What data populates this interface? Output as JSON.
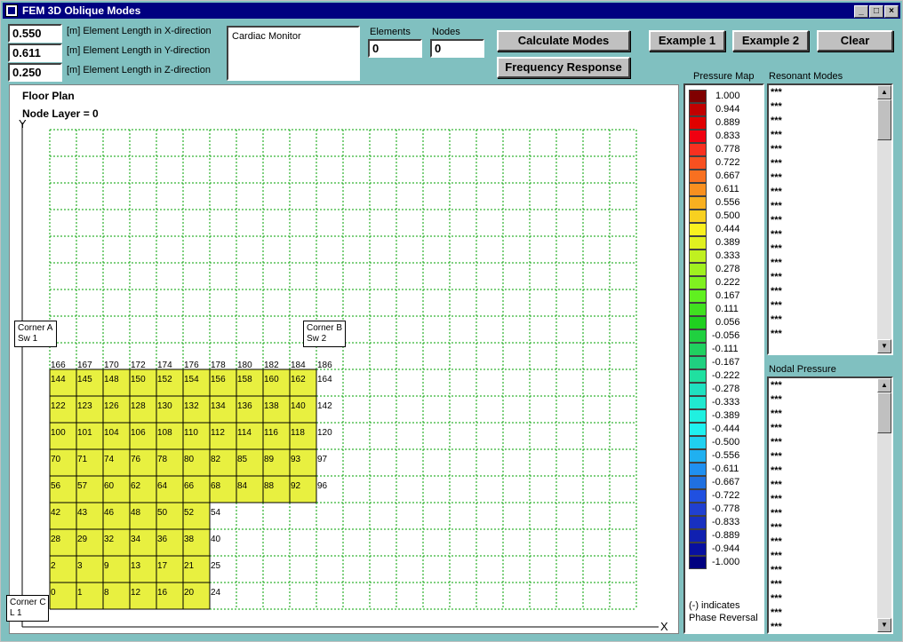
{
  "window": {
    "title": "FEM 3D Oblique Modes",
    "min": "_",
    "max": "□",
    "close": "×"
  },
  "dims": [
    {
      "value": "0.550",
      "label": "[m] Element Length in X-direction"
    },
    {
      "value": "0.611",
      "label": "[m] Element Length in Y-direction"
    },
    {
      "value": "0.250",
      "label": "[m] Element Length in Z-direction"
    }
  ],
  "description_box": "Cardiac Monitor",
  "counts": {
    "elements_label": "Elements",
    "elements_value": "0",
    "nodes_label": "Nodes",
    "nodes_value": "0"
  },
  "buttons": {
    "calculate": "Calculate Modes",
    "frequency": "Frequency Response",
    "example1": "Example 1",
    "example2": "Example 2",
    "clear": "Clear"
  },
  "floor": {
    "title": "Floor Plan",
    "layer": "Node Layer = 0",
    "y_axis": "Y",
    "x_axis": "X",
    "corner_a": [
      "Corner A",
      "Sw 1"
    ],
    "corner_b": [
      "Corner B",
      "Sw 2"
    ],
    "corner_c": [
      "Corner C",
      "L 1"
    ],
    "top_nodes": [
      "166",
      "167",
      "170",
      "172",
      "174",
      "176",
      "178",
      "180",
      "182",
      "184",
      "186"
    ],
    "rows": [
      {
        "left": [
          "144",
          "145",
          "148",
          "150",
          "152",
          "154",
          "156",
          "158",
          "160",
          "162"
        ],
        "right": "164"
      },
      {
        "left": [
          "122",
          "123",
          "126",
          "128",
          "130",
          "132",
          "134",
          "136",
          "138",
          "140"
        ],
        "right": "142"
      },
      {
        "left": [
          "100",
          "101",
          "104",
          "106",
          "108",
          "110",
          "112",
          "114",
          "116",
          "118"
        ],
        "right": "120"
      },
      {
        "left": [
          "70",
          "71",
          "74",
          "76",
          "78",
          "80",
          "82",
          "85",
          "89",
          "93"
        ],
        "right": "97"
      },
      {
        "left": [
          "56",
          "57",
          "60",
          "62",
          "64",
          "66",
          "68",
          "84",
          "88",
          "92"
        ],
        "right": "96"
      },
      {
        "left": [
          "42",
          "43",
          "46",
          "48",
          "50",
          "52"
        ],
        "right": "54"
      },
      {
        "left": [
          "28",
          "29",
          "32",
          "34",
          "36",
          "38"
        ],
        "right": "40"
      },
      {
        "left": [
          "2",
          "3",
          "9",
          "13",
          "17",
          "21"
        ],
        "right": "25"
      },
      {
        "left": [
          "0",
          "1",
          "8",
          "12",
          "16",
          "20"
        ],
        "right": "24"
      }
    ],
    "fill_color": "#e8f040",
    "grid_color": "#00a000"
  },
  "pressure_map": {
    "title": "Pressure Map",
    "entries": [
      {
        "v": "1.000",
        "c": "#800000"
      },
      {
        "v": "0.944",
        "c": "#c00000"
      },
      {
        "v": "0.889",
        "c": "#e00000"
      },
      {
        "v": "0.833",
        "c": "#f00010"
      },
      {
        "v": "0.778",
        "c": "#f83020"
      },
      {
        "v": "0.722",
        "c": "#f85020"
      },
      {
        "v": "0.667",
        "c": "#f87020"
      },
      {
        "v": "0.611",
        "c": "#f89020"
      },
      {
        "v": "0.556",
        "c": "#f8b020"
      },
      {
        "v": "0.500",
        "c": "#f8d020"
      },
      {
        "v": "0.444",
        "c": "#f8f020"
      },
      {
        "v": "0.389",
        "c": "#e0f020"
      },
      {
        "v": "0.333",
        "c": "#c0f020"
      },
      {
        "v": "0.278",
        "c": "#a0f020"
      },
      {
        "v": "0.222",
        "c": "#80f020"
      },
      {
        "v": "0.167",
        "c": "#60f020"
      },
      {
        "v": "0.111",
        "c": "#40e020"
      },
      {
        "v": "0.056",
        "c": "#20d020"
      },
      {
        "v": "-0.056",
        "c": "#20d040"
      },
      {
        "v": "-0.111",
        "c": "#20d060"
      },
      {
        "v": "-0.167",
        "c": "#20d080"
      },
      {
        "v": "-0.222",
        "c": "#20e0a0"
      },
      {
        "v": "-0.278",
        "c": "#20e0c0"
      },
      {
        "v": "-0.333",
        "c": "#20e8d0"
      },
      {
        "v": "-0.389",
        "c": "#20f0e0"
      },
      {
        "v": "-0.444",
        "c": "#20f0f0"
      },
      {
        "v": "-0.500",
        "c": "#20d0f0"
      },
      {
        "v": "-0.556",
        "c": "#20b0f0"
      },
      {
        "v": "-0.611",
        "c": "#2090f0"
      },
      {
        "v": "-0.667",
        "c": "#2070e0"
      },
      {
        "v": "-0.722",
        "c": "#2050e0"
      },
      {
        "v": "-0.778",
        "c": "#2040d0"
      },
      {
        "v": "-0.833",
        "c": "#1830c0"
      },
      {
        "v": "-0.889",
        "c": "#1020b0"
      },
      {
        "v": "-0.944",
        "c": "#0810a0"
      },
      {
        "v": "-1.000",
        "c": "#000080"
      }
    ],
    "note1": "(-) indicates",
    "note2": "Phase Reversal"
  },
  "resonant": {
    "title": "Resonant Modes",
    "items": [
      "***",
      "***",
      "***",
      "***",
      "***",
      "***",
      "***",
      "***",
      "***",
      "***",
      "***",
      "***",
      "***",
      "***",
      "***",
      "***",
      "***",
      "***"
    ]
  },
  "nodal": {
    "title": "Nodal Pressure",
    "items": [
      "***",
      "***",
      "***",
      "***",
      "***",
      "***",
      "***",
      "***",
      "***",
      "***",
      "***",
      "***",
      "***",
      "***",
      "***",
      "***",
      "***",
      "***"
    ]
  }
}
